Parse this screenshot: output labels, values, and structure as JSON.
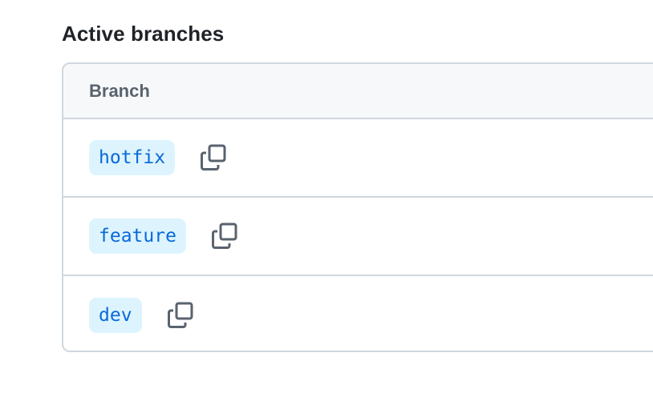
{
  "section": {
    "title": "Active branches"
  },
  "table": {
    "header": "Branch",
    "rows": [
      {
        "branch": "hotfix",
        "copy_icon": "copy-icon"
      },
      {
        "branch": "feature",
        "copy_icon": "copy-icon"
      },
      {
        "branch": "dev",
        "copy_icon": "copy-icon"
      }
    ]
  },
  "colors": {
    "pill_bg": "#ddf4ff",
    "pill_text": "#0969da",
    "border": "#d0d7de",
    "header_bg": "#f6f8fa",
    "header_text": "#59636e",
    "title_text": "#1f2328",
    "icon": "#59636e"
  }
}
